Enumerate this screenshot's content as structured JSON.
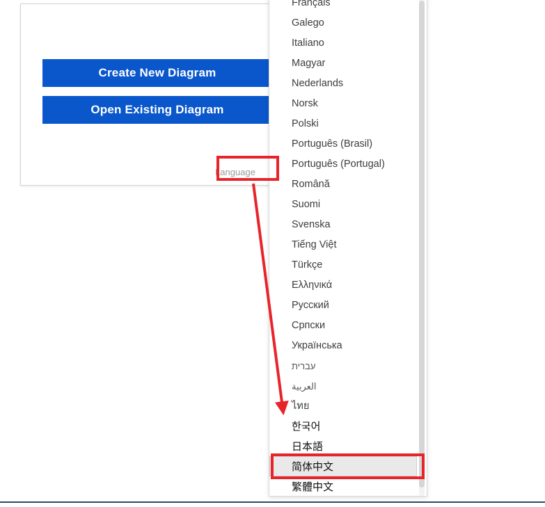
{
  "dialog": {
    "create_new_label": "Create New Diagram",
    "open_existing_label": "Open Existing Diagram",
    "language_label": "Language"
  },
  "dropdown": {
    "items": [
      {
        "label": "Français",
        "script": "latin",
        "selected": false
      },
      {
        "label": "Galego",
        "script": "latin",
        "selected": false
      },
      {
        "label": "Italiano",
        "script": "latin",
        "selected": false
      },
      {
        "label": "Magyar",
        "script": "latin",
        "selected": false
      },
      {
        "label": "Nederlands",
        "script": "latin",
        "selected": false
      },
      {
        "label": "Norsk",
        "script": "latin",
        "selected": false
      },
      {
        "label": "Polski",
        "script": "latin",
        "selected": false
      },
      {
        "label": "Português (Brasil)",
        "script": "latin",
        "selected": false
      },
      {
        "label": "Português (Portugal)",
        "script": "latin",
        "selected": false
      },
      {
        "label": "Română",
        "script": "latin",
        "selected": false
      },
      {
        "label": "Suomi",
        "script": "latin",
        "selected": false
      },
      {
        "label": "Svenska",
        "script": "latin",
        "selected": false
      },
      {
        "label": "Tiếng Việt",
        "script": "latin",
        "selected": false
      },
      {
        "label": "Türkçe",
        "script": "latin",
        "selected": false
      },
      {
        "label": "Ελληνικά",
        "script": "greek",
        "selected": false
      },
      {
        "label": "Русский",
        "script": "cyrillic",
        "selected": false
      },
      {
        "label": "Српски",
        "script": "cyrillic",
        "selected": false
      },
      {
        "label": "Українська",
        "script": "cyrillic",
        "selected": false
      },
      {
        "label": "עברית",
        "script": "rtl",
        "selected": false
      },
      {
        "label": "العربية",
        "script": "rtl",
        "selected": false
      },
      {
        "label": "ไทย",
        "script": "thai",
        "selected": false
      },
      {
        "label": "한국어",
        "script": "cjk",
        "selected": false
      },
      {
        "label": "日本語",
        "script": "cjk",
        "selected": false
      },
      {
        "label": "简体中文",
        "script": "cjk",
        "selected": true
      },
      {
        "label": "繁體中文",
        "script": "cjk",
        "selected": false
      }
    ]
  },
  "colors": {
    "button_blue": "#0a57cc",
    "annotation_red": "#e8242a",
    "selected_row": "#e9e9e9",
    "bottom_rule": "#2d4a63"
  }
}
